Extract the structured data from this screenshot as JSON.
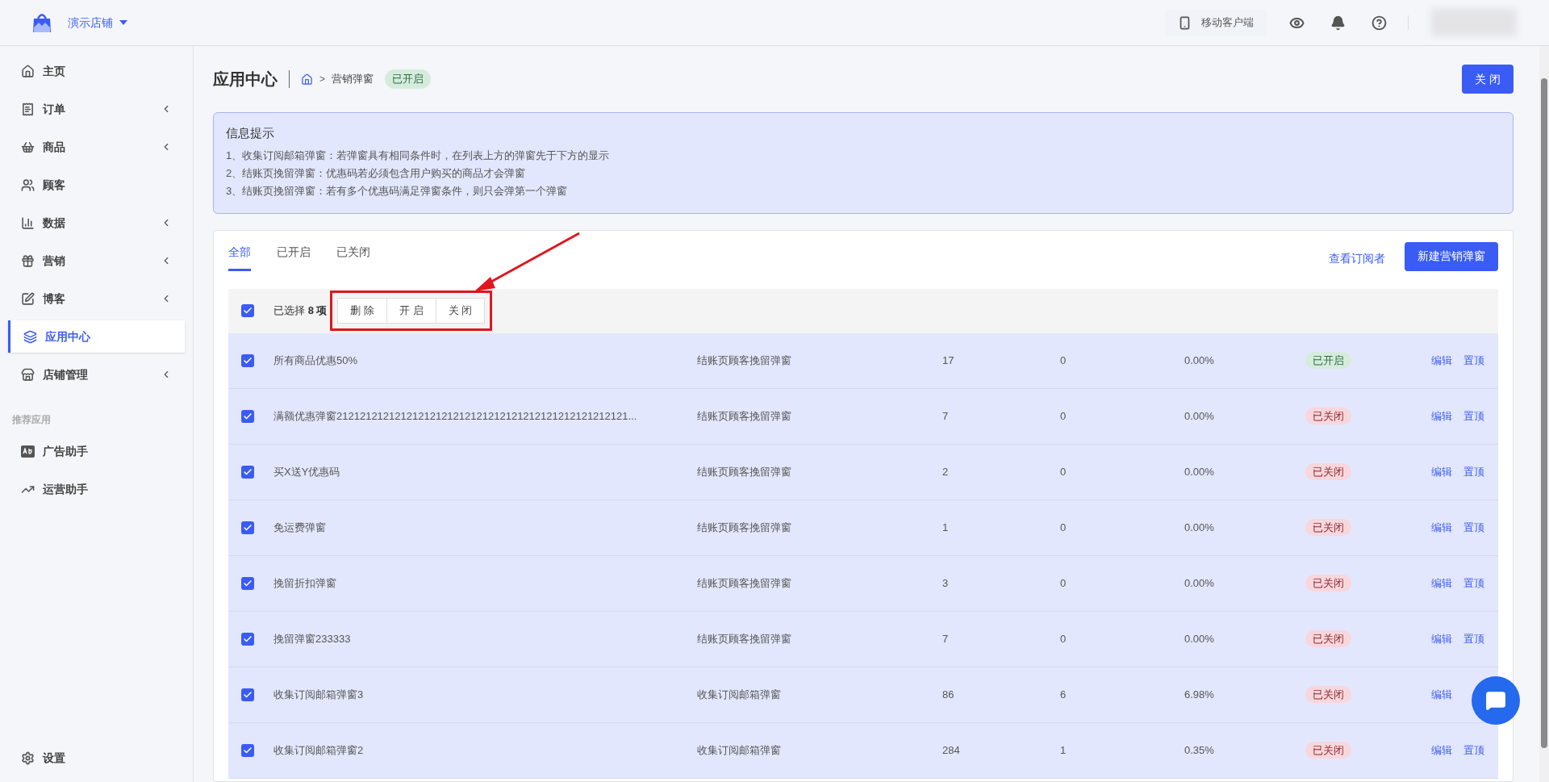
{
  "header": {
    "store_name": "演示店铺",
    "mobile_client": "移动客户端"
  },
  "sidebar": {
    "items": [
      {
        "label": "主页",
        "expandable": false,
        "selected": false
      },
      {
        "label": "订单",
        "expandable": true,
        "selected": false
      },
      {
        "label": "商品",
        "expandable": true,
        "selected": false
      },
      {
        "label": "顾客",
        "expandable": false,
        "selected": false
      },
      {
        "label": "数据",
        "expandable": true,
        "selected": false
      },
      {
        "label": "营销",
        "expandable": true,
        "selected": false
      },
      {
        "label": "博客",
        "expandable": true,
        "selected": false
      },
      {
        "label": "应用中心",
        "expandable": false,
        "selected": true
      },
      {
        "label": "店铺管理",
        "expandable": true,
        "selected": false
      }
    ],
    "section_title": "推荐应用",
    "apps": [
      {
        "label": "广告助手"
      },
      {
        "label": "运营助手"
      }
    ],
    "settings": "设置"
  },
  "page": {
    "title": "应用中心",
    "breadcrumb_separator": ">",
    "breadcrumb": "营销弹窗",
    "status": "已开启",
    "close_button": "关 闭"
  },
  "info": {
    "title": "信息提示",
    "lines": [
      "1、收集订阅邮箱弹窗：若弹窗具有相同条件时，在列表上方的弹窗先于下方的显示",
      "2、结账页挽留弹窗：优惠码若必须包含用户购买的商品才会弹窗",
      "3、结账页挽留弹窗：若有多个优惠码满足弹窗条件，则只会弹第一个弹窗"
    ]
  },
  "tabs": [
    {
      "label": "全部",
      "selected": true
    },
    {
      "label": "已开启",
      "selected": false
    },
    {
      "label": "已关闭",
      "selected": false
    }
  ],
  "view_subscribers": "查看订阅者",
  "new_button": "新建营销弹窗",
  "bulk": {
    "checked": true,
    "selected_prefix": "已选择",
    "selected_count": "8 项",
    "actions": [
      "删 除",
      "开 启",
      "关 闭"
    ]
  },
  "rows": [
    {
      "checked": true,
      "name": "所有商品优惠50%",
      "type": "结账页顾客挽留弹窗",
      "column_3": "17",
      "column_4": "0",
      "column_5": "0.00%",
      "status": "已开启",
      "on": true,
      "actions": [
        "编辑",
        "置顶"
      ]
    },
    {
      "checked": true,
      "name": "满额优惠弹窗21212121212121212121212121212121212121212121212121...",
      "type": "结账页顾客挽留弹窗",
      "column_3": "7",
      "column_4": "0",
      "column_5": "0.00%",
      "status": "已关闭",
      "on": false,
      "actions": [
        "编辑",
        "置顶"
      ]
    },
    {
      "checked": true,
      "name": "买X送Y优惠码",
      "type": "结账页顾客挽留弹窗",
      "column_3": "2",
      "column_4": "0",
      "column_5": "0.00%",
      "status": "已关闭",
      "on": false,
      "actions": [
        "编辑",
        "置顶"
      ]
    },
    {
      "checked": true,
      "name": "免运费弹窗",
      "type": "结账页顾客挽留弹窗",
      "column_3": "1",
      "column_4": "0",
      "column_5": "0.00%",
      "status": "已关闭",
      "on": false,
      "actions": [
        "编辑",
        "置顶"
      ]
    },
    {
      "checked": true,
      "name": "挽留折扣弹窗",
      "type": "结账页顾客挽留弹窗",
      "column_3": "3",
      "column_4": "0",
      "column_5": "0.00%",
      "status": "已关闭",
      "on": false,
      "actions": [
        "编辑",
        "置顶"
      ]
    },
    {
      "checked": true,
      "name": "挽留弹窗233333",
      "type": "结账页顾客挽留弹窗",
      "column_3": "7",
      "column_4": "0",
      "column_5": "0.00%",
      "status": "已关闭",
      "on": false,
      "actions": [
        "编辑",
        "置顶"
      ]
    },
    {
      "checked": true,
      "name": "收集订阅邮箱弹窗3",
      "type": "收集订阅邮箱弹窗",
      "column_3": "86",
      "column_4": "6",
      "column_5": "6.98%",
      "status": "已关闭",
      "on": false,
      "actions": [
        "编辑"
      ]
    },
    {
      "checked": true,
      "name": "收集订阅邮箱弹窗2",
      "type": "收集订阅邮箱弹窗",
      "column_3": "284",
      "column_4": "1",
      "column_5": "0.35%",
      "status": "已关闭",
      "on": false,
      "actions": [
        "编辑",
        "置顶"
      ]
    }
  ]
}
